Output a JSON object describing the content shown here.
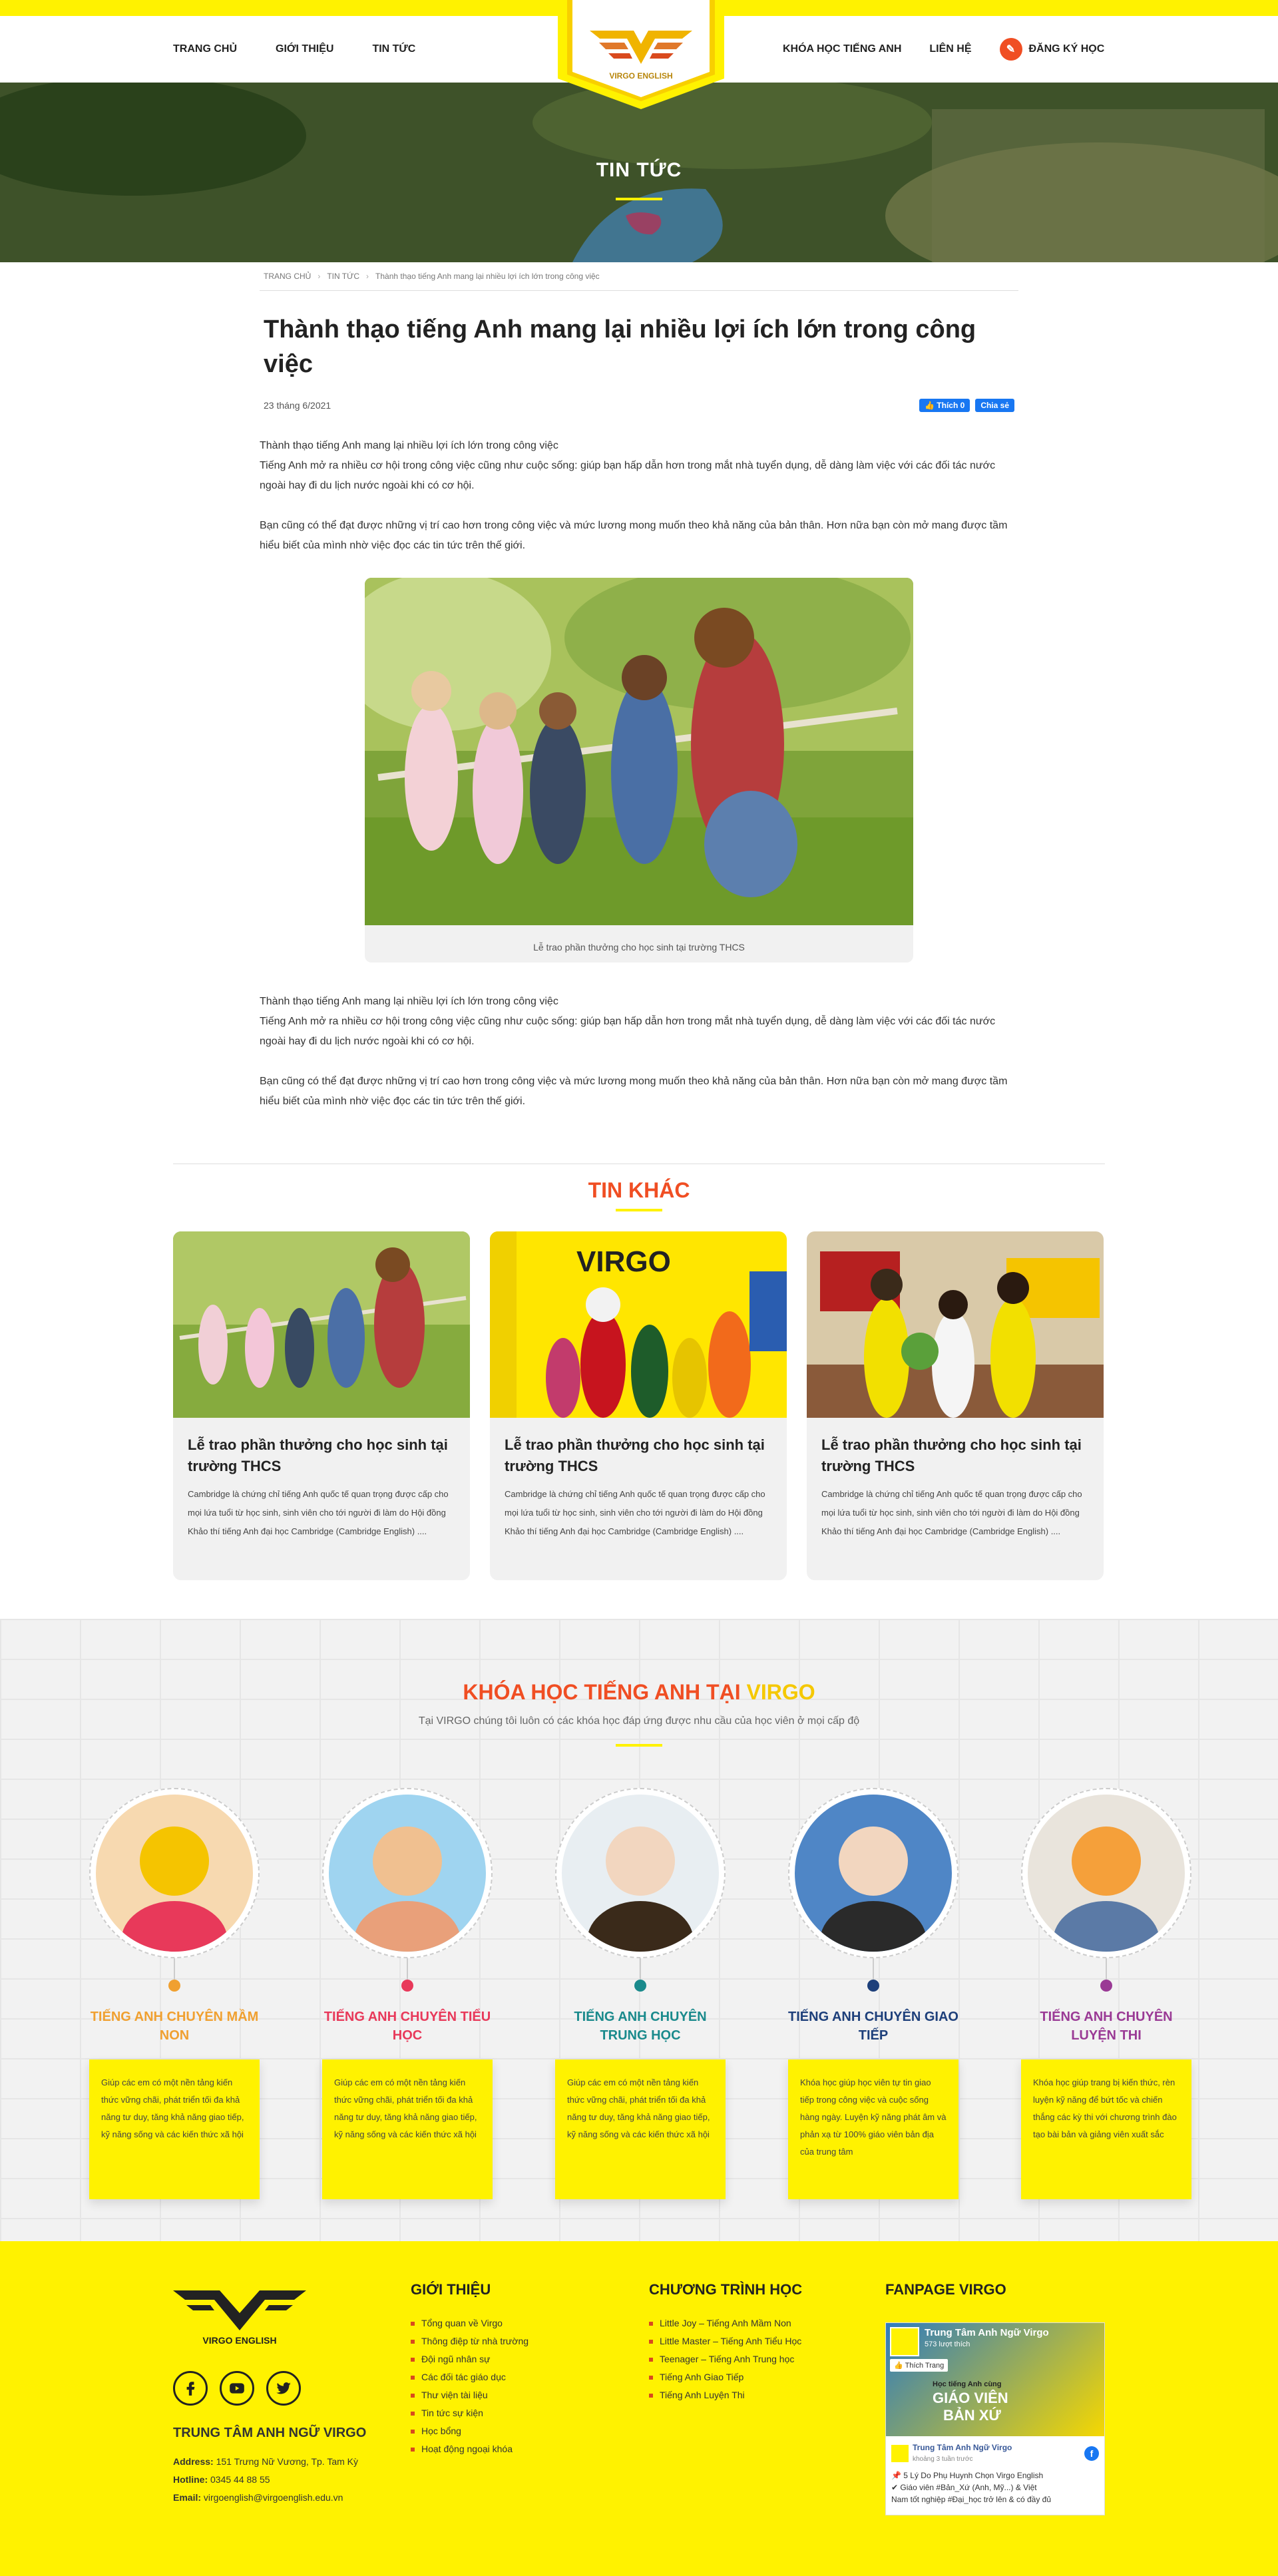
{
  "nav": {
    "home": "TRANG CHỦ",
    "about": "GIỚI THIỆU",
    "news": "TIN TỨC",
    "courses": "KHÓA HỌC TIẾNG ANH",
    "contact": "LIÊN HỆ",
    "register": "ĐĂNG KÝ HỌC"
  },
  "logo": {
    "text": "VIRGO ENGLISH"
  },
  "hero": {
    "title": "TIN TỨC"
  },
  "breadcrumb": [
    "TRANG CHỦ",
    "TIN TỨC",
    "Thành thạo tiếng Anh mang lại nhiều lợi ích lớn trong công việc"
  ],
  "article": {
    "title": "Thành thạo tiếng Anh mang lại nhiều lợi ích lớn trong công việc",
    "date": "23 tháng 6/2021",
    "like_label": "Thích 0",
    "share_label": "Chia sẻ",
    "p1a": "Thành thạo tiếng Anh mang lại nhiều lợi ích lớn trong công việc",
    "p1b": "Tiếng Anh mở ra nhiều cơ hội trong công việc cũng như cuộc sống: giúp bạn hấp dẫn hơn trong mắt nhà tuyển dụng, dễ dàng làm việc với các đối tác nước ngoài hay đi du lịch nước ngoài khi có cơ hội.",
    "p2": "Bạn cũng có thể đạt được những vị trí cao hơn trong công việc và mức lương mong muốn theo khả năng của bản thân. Hơn nữa bạn còn mở mang được tầm hiểu biết của mình nhờ việc đọc các tin tức trên thế giới.",
    "caption": "Lễ trao phần thưởng cho học sinh tại trường THCS"
  },
  "other_news": {
    "title": "TIN KHÁC",
    "cards": [
      {
        "title": "Lễ trao phần thưởng cho học sinh tại trường THCS",
        "text": "Cambridge là chứng chỉ tiếng Anh quốc tế quan trọng được cấp cho mọi lứa tuổi từ học sinh, sinh viên cho tới người đi làm do Hội đồng Khảo thí tiếng Anh đại học Cambridge (Cambridge English) ...."
      },
      {
        "title": "Lễ trao phần thưởng cho học sinh tại trường THCS",
        "text": "Cambridge là chứng chỉ tiếng Anh quốc tế quan trọng được cấp cho mọi lứa tuổi từ học sinh, sinh viên cho tới người đi làm do Hội đồng Khảo thí tiếng Anh đại học Cambridge (Cambridge English) ...."
      },
      {
        "title": "Lễ trao phần thưởng cho học sinh tại trường THCS",
        "text": "Cambridge là chứng chỉ tiếng Anh quốc tế quan trọng được cấp cho mọi lứa tuổi từ học sinh, sinh viên cho tới người đi làm do Hội đồng Khảo thí tiếng Anh đại học Cambridge (Cambridge English) ...."
      }
    ]
  },
  "courses": {
    "title_a": "KHÓA HỌC TIẾNG ANH TẠI ",
    "title_b": "VIRGO",
    "subtitle": "Tại VIRGO chúng tôi luôn có các khóa học đáp ứng được nhu cầu của học viên ở mọi cấp độ",
    "items": [
      {
        "name": "TIẾNG ANH CHUYÊN MẦM NON",
        "text": "Giúp các em có một nền tảng kiến thức vững chãi, phát triển tối đa khả năng tư duy, tăng khả năng giao tiếp, kỹ năng sống và các kiến thức xã hội",
        "color": "#f0a030"
      },
      {
        "name": "TIẾNG ANH CHUYÊN TIỂU HỌC",
        "text": "Giúp các em có một nền tảng kiến thức vững chãi, phát triển tối đa khả năng tư duy, tăng khả năng giao tiếp, kỹ năng sống và các kiến thức xã hội",
        "color": "#e8395a"
      },
      {
        "name": "TIẾNG ANH CHUYÊN TRUNG HỌC",
        "text": "Giúp các em có một nền tảng kiến thức vững chãi, phát triển tối đa khả năng tư duy, tăng khả năng giao tiếp, kỹ năng sống và các kiến thức xã hội",
        "color": "#1a8a8c"
      },
      {
        "name": "TIẾNG ANH CHUYÊN GIAO TIẾP",
        "text": "Khóa học giúp học viên tự tin giao tiếp trong công việc và cuộc sống hàng ngày. Luyện kỹ năng phát âm và phản xạ từ 100% giáo viên bản địa của trung tâm",
        "color": "#1d3f7a"
      },
      {
        "name": "TIẾNG ANH CHUYÊN LUYỆN THI",
        "text": "Khóa học giúp trang bị kiến thức, rèn luyện kỹ năng để bứt tốc và chiến thắng các kỳ thi với chương trình đào tạo bài bản và giảng viên xuất sắc",
        "color": "#9a3a95"
      }
    ]
  },
  "footer": {
    "logo_text": "VIRGO ENGLISH",
    "center_name": "TRUNG TÂM ANH NGỮ VIRGO",
    "address_label": "Address:",
    "address": "151 Trưng Nữ Vương, Tp. Tam Kỳ",
    "hotline_label": "Hotline:",
    "hotline": "0345 44 88 55",
    "email_label": "Email:",
    "email": "virgoenglish@virgoenglish.edu.vn",
    "about_title": "GIỚI THIỆU",
    "about_links": [
      "Tổng quan về Virgo",
      "Thông điệp từ nhà trường",
      "Đội ngũ nhân sự",
      "Các đối tác giáo dục",
      "Thư viện tài liệu",
      "Tin tức sự kiện",
      "Học bổng",
      "Hoạt động ngoại khóa"
    ],
    "program_title": "CHƯƠNG TRÌNH HỌC",
    "program_links": [
      "Little Joy – Tiếng Anh Mầm Non",
      "Little Master – Tiếng Anh Tiểu Học",
      "Teenager – Tiếng Anh Trung học",
      "Tiếng Anh Giao Tiếp",
      "Tiếng Anh Luyện Thi"
    ],
    "fanpage_title": "FANPAGE VIRGO",
    "fb_name": "Trung Tâm Anh Ngữ Virgo",
    "fb_likes": "573 lượt thích",
    "fb_like_btn": "Thích Trang",
    "fb_banner_a": "Học tiếng Anh cùng",
    "fb_banner_b": "GIÁO VIÊN",
    "fb_banner_c": "BẢN XỨ",
    "fb_post_name": "Trung Tâm Anh Ngữ Virgo",
    "fb_post_time": "khoảng 3 tuần trước",
    "fb_post_l1": "📌 5 Lý Do Phụ Huynh Chọn Virgo English",
    "fb_post_l2": "✔ Giáo viên #Bản_Xứ (Anh, Mỹ...) & Việt",
    "fb_post_l3": "Nam tốt nghiệp #Đại_học trở lên & có đầy đủ"
  }
}
